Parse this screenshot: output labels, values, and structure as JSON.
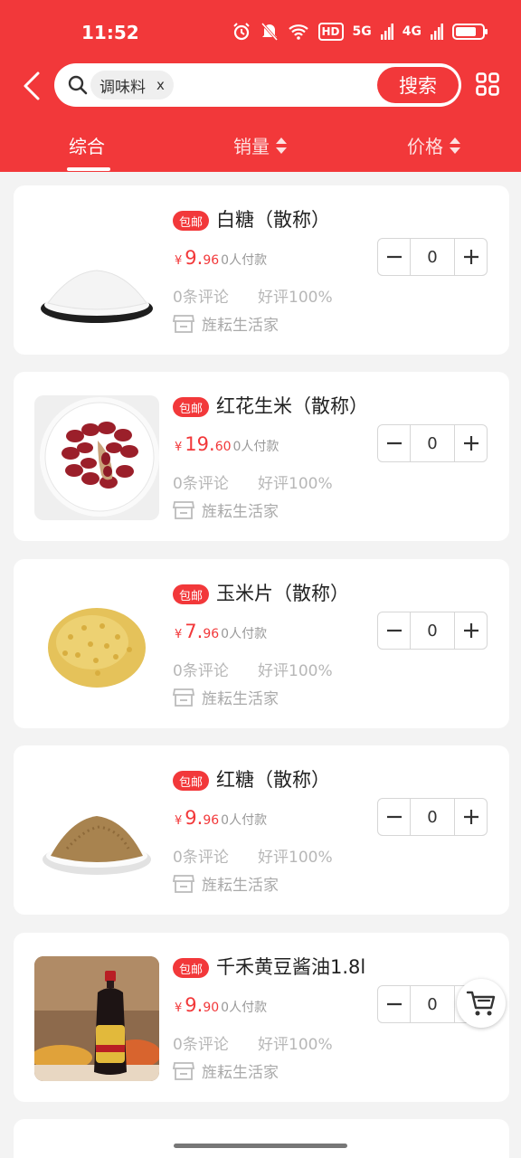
{
  "status_bar": {
    "time": "11:52",
    "hd": "HD",
    "net1": "5G",
    "net2": "4G"
  },
  "search": {
    "tag": "调味料",
    "tag_close": "x",
    "button": "搜索"
  },
  "tabs": [
    {
      "label": "综合",
      "active": true
    },
    {
      "label": "销量",
      "sortable": true
    },
    {
      "label": "价格",
      "sortable": true
    }
  ],
  "accent_color": "#f2383a",
  "products": [
    {
      "badge": "包邮",
      "name": "白糖（散称）",
      "currency": "¥",
      "price_int": "9.",
      "price_dec": "96",
      "paid": "0人付款",
      "reviews": "0条评论",
      "rating": "好评100%",
      "shop": "旌耘生活家",
      "qty": "0",
      "image": "sugar-image"
    },
    {
      "badge": "包邮",
      "name": "红花生米（散称）",
      "currency": "¥",
      "price_int": "19.",
      "price_dec": "60",
      "paid": "0人付款",
      "reviews": "0条评论",
      "rating": "好评100%",
      "shop": "旌耘生活家",
      "qty": "0",
      "image": "peanut-image"
    },
    {
      "badge": "包邮",
      "name": "玉米片（散称）",
      "currency": "¥",
      "price_int": "7.",
      "price_dec": "96",
      "paid": "0人付款",
      "reviews": "0条评论",
      "rating": "好评100%",
      "shop": "旌耘生活家",
      "qty": "0",
      "image": "corn-flakes-image"
    },
    {
      "badge": "包邮",
      "name": "红糖（散称）",
      "currency": "¥",
      "price_int": "9.",
      "price_dec": "96",
      "paid": "0人付款",
      "reviews": "0条评论",
      "rating": "好评100%",
      "shop": "旌耘生活家",
      "qty": "0",
      "image": "brown-sugar-image"
    },
    {
      "badge": "包邮",
      "name": "千禾黄豆酱油1.8l",
      "currency": "¥",
      "price_int": "9.",
      "price_dec": "90",
      "paid": "0人付款",
      "reviews": "0条评论",
      "rating": "好评100%",
      "shop": "旌耘生活家",
      "qty": "0",
      "image": "soy-sauce-image"
    }
  ],
  "icons": [
    "back-icon",
    "search-icon",
    "grid-menu-icon",
    "sort-icon",
    "store-icon",
    "minus-icon",
    "plus-icon",
    "cart-icon"
  ]
}
